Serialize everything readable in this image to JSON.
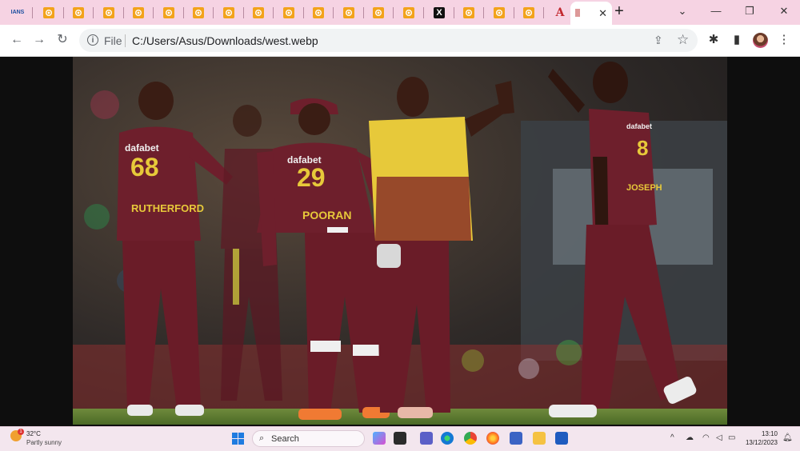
{
  "browser": {
    "tabs": [
      {
        "favicon": "ians-logo-icon",
        "label": "IANS"
      },
      {
        "favicon": "orange-flower-icon"
      },
      {
        "favicon": "orange-flower-icon"
      },
      {
        "favicon": "orange-flower-icon"
      },
      {
        "favicon": "orange-flower-icon"
      },
      {
        "favicon": "orange-flower-icon"
      },
      {
        "favicon": "orange-flower-icon"
      },
      {
        "favicon": "orange-flower-icon"
      },
      {
        "favicon": "orange-flower-icon"
      },
      {
        "favicon": "orange-flower-icon"
      },
      {
        "favicon": "orange-flower-icon"
      },
      {
        "favicon": "orange-flower-icon"
      },
      {
        "favicon": "orange-flower-icon"
      },
      {
        "favicon": "orange-flower-icon"
      },
      {
        "favicon": "x-logo-icon",
        "label": "X"
      },
      {
        "favicon": "orange-flower-icon"
      },
      {
        "favicon": "orange-flower-icon"
      },
      {
        "favicon": "orange-flower-icon"
      },
      {
        "favicon": "a-logo-icon",
        "label": "A"
      }
    ],
    "active_tab": {
      "close_glyph": "✕"
    },
    "new_tab_glyph": "+",
    "tab_search_glyph": "⌄",
    "window_controls": {
      "minimize": "—",
      "restore": "❐",
      "close": "✕"
    },
    "toolbar": {
      "back": "←",
      "forward": "→",
      "reload": "↻",
      "scheme_label": "File",
      "url": "C:/Users/Asus/Downloads/west.webp",
      "share_glyph": "⇪",
      "star_glyph": "☆",
      "extensions_glyph": "✱",
      "sidepanel_glyph": "▮",
      "menu_glyph": "⋮"
    }
  },
  "photo": {
    "players": [
      {
        "number": "68",
        "name": "RUTHERFORD",
        "sponsor": "dafabet"
      },
      {
        "number": "29",
        "name": "POORAN",
        "sponsor": "dafabet"
      },
      {
        "number": "8",
        "name": "JOSEPH",
        "sponsor": "dafabet"
      }
    ]
  },
  "taskbar": {
    "weather": {
      "temp": "32°C",
      "desc": "Partly sunny",
      "badge": "1"
    },
    "search_label": "Search",
    "clock": {
      "time": "13:10",
      "date": "13/12/2023"
    },
    "tray_up": "^"
  },
  "colors": {
    "tabstrip": "#f6d3e3",
    "jersey_maroon": "#6e1f2c",
    "jersey_yellow": "#e7c93a"
  }
}
